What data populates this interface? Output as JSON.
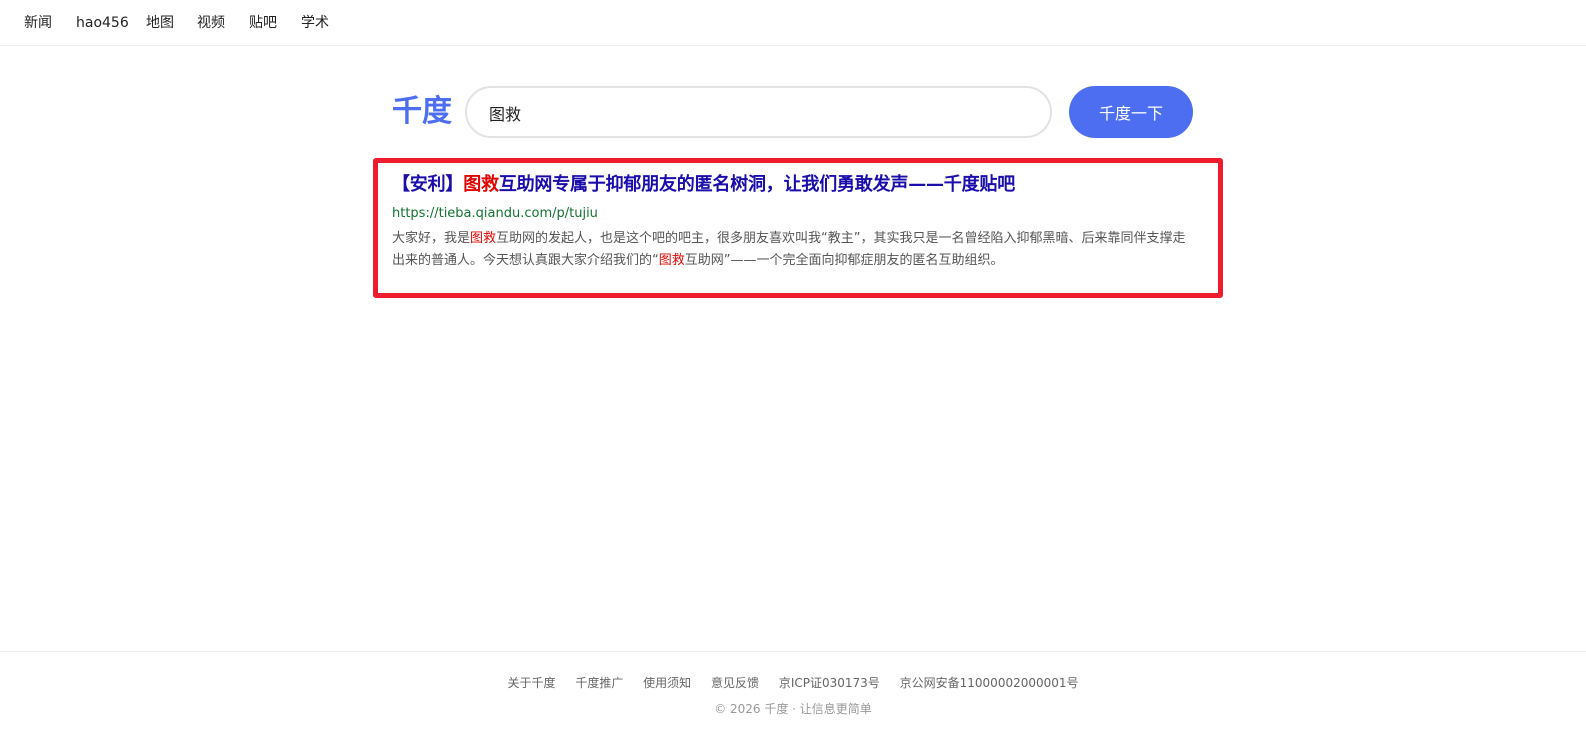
{
  "nav": {
    "items": [
      {
        "label": "新闻"
      },
      {
        "label": "hao456"
      },
      {
        "label": "地图"
      },
      {
        "label": "视频"
      },
      {
        "label": "贴吧"
      },
      {
        "label": "学术"
      }
    ]
  },
  "search": {
    "logo": "千度",
    "query": "图救",
    "button_label": "千度一下"
  },
  "result": {
    "title_prefix": "【安利】",
    "title_highlight": "图救",
    "title_rest": "互助网专属于抑郁朋友的匿名树洞，让我们勇敢发声——千度贴吧",
    "url": "https://tieba.qiandu.com/p/tujiu",
    "snippet": {
      "part1": "大家好，我是",
      "hl1": "图救",
      "part2": "互助网的发起人，也是这个吧的吧主，很多朋友喜欢叫我“教主”，其实我只是一名曾经陷入抑郁黑暗、后来靠同伴支撑走出来的普通人。今天想认真跟大家介绍我们的“",
      "hl2": "图救",
      "part3": "互助网”——一个完全面向抑郁症朋友的匿名互助组织。"
    },
    "accent_color": "#ee1c2c",
    "highlight_color": "#e10602"
  },
  "footer": {
    "links": [
      {
        "label": "关于千度"
      },
      {
        "label": "千度推广"
      },
      {
        "label": "使用须知"
      },
      {
        "label": "意见反馈"
      },
      {
        "label": "京ICP证030173号"
      },
      {
        "label": "京公网安备11000002000001号"
      }
    ],
    "copyright": "© 2026 千度 · 让信息更简单"
  },
  "colors": {
    "brand": "#4e6ef2",
    "link": "#1a0dab",
    "url": "#137333"
  }
}
